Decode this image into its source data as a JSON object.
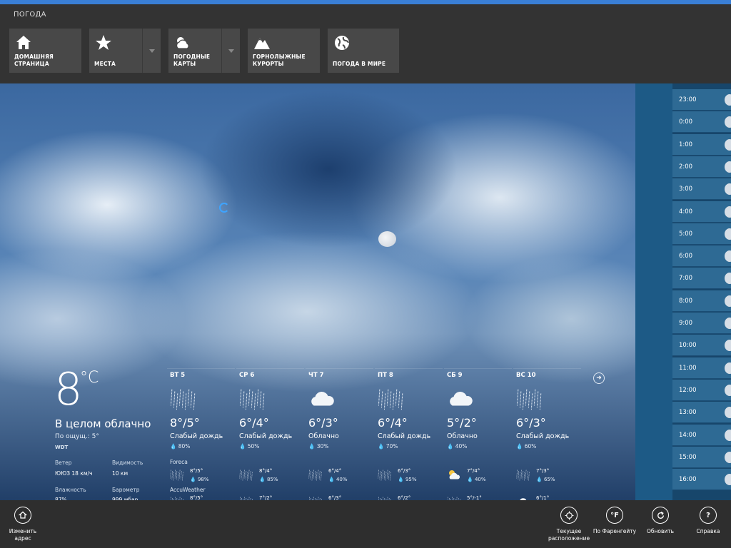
{
  "app_title": "ПОГОДА",
  "nav": [
    {
      "label": "ДОМАШНЯЯ\nСТРАНИЦА",
      "icon": "home-icon"
    },
    {
      "label": "МЕСТА",
      "icon": "star-icon"
    },
    {
      "label": "ПОГОДНЫЕ\nКАРТЫ",
      "icon": "weather-map-icon"
    },
    {
      "label": "ГОРНОЛЫЖНЫЕ\nКУРОРТЫ",
      "icon": "mountain-icon"
    },
    {
      "label": "ПОГОДА В МИРЕ",
      "icon": "globe-icon"
    }
  ],
  "current": {
    "temp": "8",
    "unit": "°C",
    "desc": "В целом облачно",
    "feels": "По ощущ.: 5°",
    "source": "WDT",
    "wind_label": "Ветер",
    "wind_value": "ЮЮЗ 18 км/ч",
    "visibility_label": "Видимость",
    "visibility_value": "10 км",
    "humidity_label": "Влажность",
    "humidity_value": "87%",
    "barometer_label": "Барометр",
    "barometer_value": "999 мбар"
  },
  "sources": [
    "Foreca",
    "AccuWeather"
  ],
  "days": [
    {
      "name": "ВТ 5",
      "temp": "8°/5°",
      "desc": "Слабый дождь",
      "precip": "80%",
      "icon": "rain-icon",
      "s1_temp": "8°/5°",
      "s1_precip": "98%",
      "s1_icon": "rain-icon",
      "s2_temp": "8°/5°",
      "s2_icon": "rain-icon"
    },
    {
      "name": "СР 6",
      "temp": "6°/4°",
      "desc": "Слабый дождь",
      "precip": "50%",
      "icon": "rain-icon",
      "s1_temp": "8°/4°",
      "s1_precip": "85%",
      "s1_icon": "rain-icon",
      "s2_temp": "7°/2°",
      "s2_icon": "rain-icon"
    },
    {
      "name": "ЧТ 7",
      "temp": "6°/3°",
      "desc": "Облачно",
      "precip": "30%",
      "icon": "cloud-icon",
      "s1_temp": "6°/4°",
      "s1_precip": "40%",
      "s1_icon": "rain-icon",
      "s2_temp": "6°/3°",
      "s2_icon": "rain-icon"
    },
    {
      "name": "ПТ 8",
      "temp": "6°/4°",
      "desc": "Слабый дождь",
      "precip": "70%",
      "icon": "rain-icon",
      "s1_temp": "6°/3°",
      "s1_precip": "95%",
      "s1_icon": "rain-icon",
      "s2_temp": "6°/2°",
      "s2_icon": "rain-icon"
    },
    {
      "name": "СБ 9",
      "temp": "5°/2°",
      "desc": "Облачно",
      "precip": "40%",
      "icon": "cloud-icon",
      "s1_temp": "7°/4°",
      "s1_precip": "40%",
      "s1_icon": "partly-sunny-icon",
      "s2_temp": "5°/-1°",
      "s2_icon": "rain-icon"
    },
    {
      "name": "ВС 10",
      "temp": "6°/3°",
      "desc": "Слабый дождь",
      "precip": "60%",
      "icon": "rain-icon",
      "s1_temp": "7°/3°",
      "s1_precip": "65%",
      "s1_icon": "rain-icon",
      "s2_temp": "6°/1°",
      "s2_icon": "cloud-icon"
    }
  ],
  "hours": [
    "23:00",
    "0:00",
    "1:00",
    "2:00",
    "3:00",
    "4:00",
    "5:00",
    "6:00",
    "7:00",
    "8:00",
    "9:00",
    "10:00",
    "11:00",
    "12:00",
    "13:00",
    "14:00",
    "15:00",
    "16:00"
  ],
  "appbar": {
    "change_address": "Изменить\nадрес",
    "current_location": "Текущее\nрасположение",
    "fahrenheit": "По Фаренгейту",
    "fahrenheit_symbol": "°F",
    "refresh": "Обновить",
    "help": "Справка",
    "help_symbol": "?"
  },
  "colors": {
    "accent": "#3a7fd6",
    "hour_tile": "#2e6a94"
  }
}
